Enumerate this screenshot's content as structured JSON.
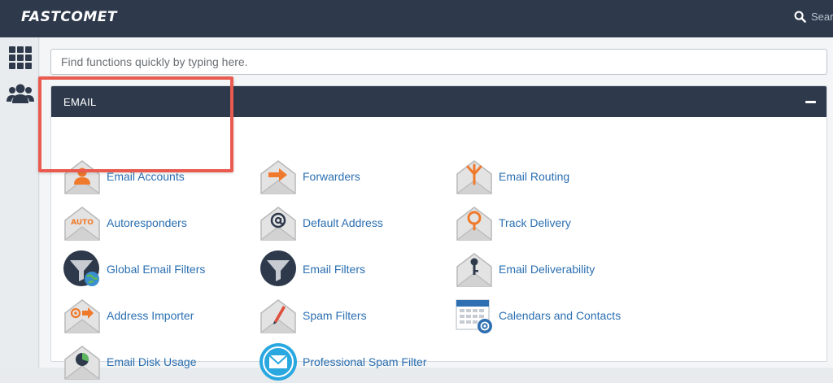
{
  "header": {
    "logo_text": "FASTCOMET",
    "search_text": "Sear"
  },
  "search": {
    "placeholder": "Find functions quickly by typing here."
  },
  "email_panel": {
    "title": "EMAIL",
    "items": [
      {
        "label": "Email Accounts",
        "icon": "email-accounts-icon"
      },
      {
        "label": "Forwarders",
        "icon": "forwarders-icon"
      },
      {
        "label": "Email Routing",
        "icon": "email-routing-icon"
      },
      {
        "label": "Autoresponders",
        "icon": "autoresponders-icon",
        "icon_text": "AUTO"
      },
      {
        "label": "Default Address",
        "icon": "default-address-icon"
      },
      {
        "label": "Track Delivery",
        "icon": "track-delivery-icon"
      },
      {
        "label": "Global Email Filters",
        "icon": "global-email-filters-icon"
      },
      {
        "label": "Email Filters",
        "icon": "email-filters-icon"
      },
      {
        "label": "Email Deliverability",
        "icon": "email-deliverability-icon"
      },
      {
        "label": "Address Importer",
        "icon": "address-importer-icon"
      },
      {
        "label": "Spam Filters",
        "icon": "spam-filters-icon"
      },
      {
        "label": "Calendars and Contacts",
        "icon": "calendars-contacts-icon"
      },
      {
        "label": "Email Disk Usage",
        "icon": "email-disk-usage-icon"
      },
      {
        "label": "Professional Spam Filter",
        "icon": "professional-spam-filter-icon"
      }
    ]
  },
  "colors": {
    "header_bg": "#2e3a4c",
    "link": "#2a6fb1",
    "accent_orange": "#f07a2b",
    "highlight_red": "#ea5b4f"
  }
}
